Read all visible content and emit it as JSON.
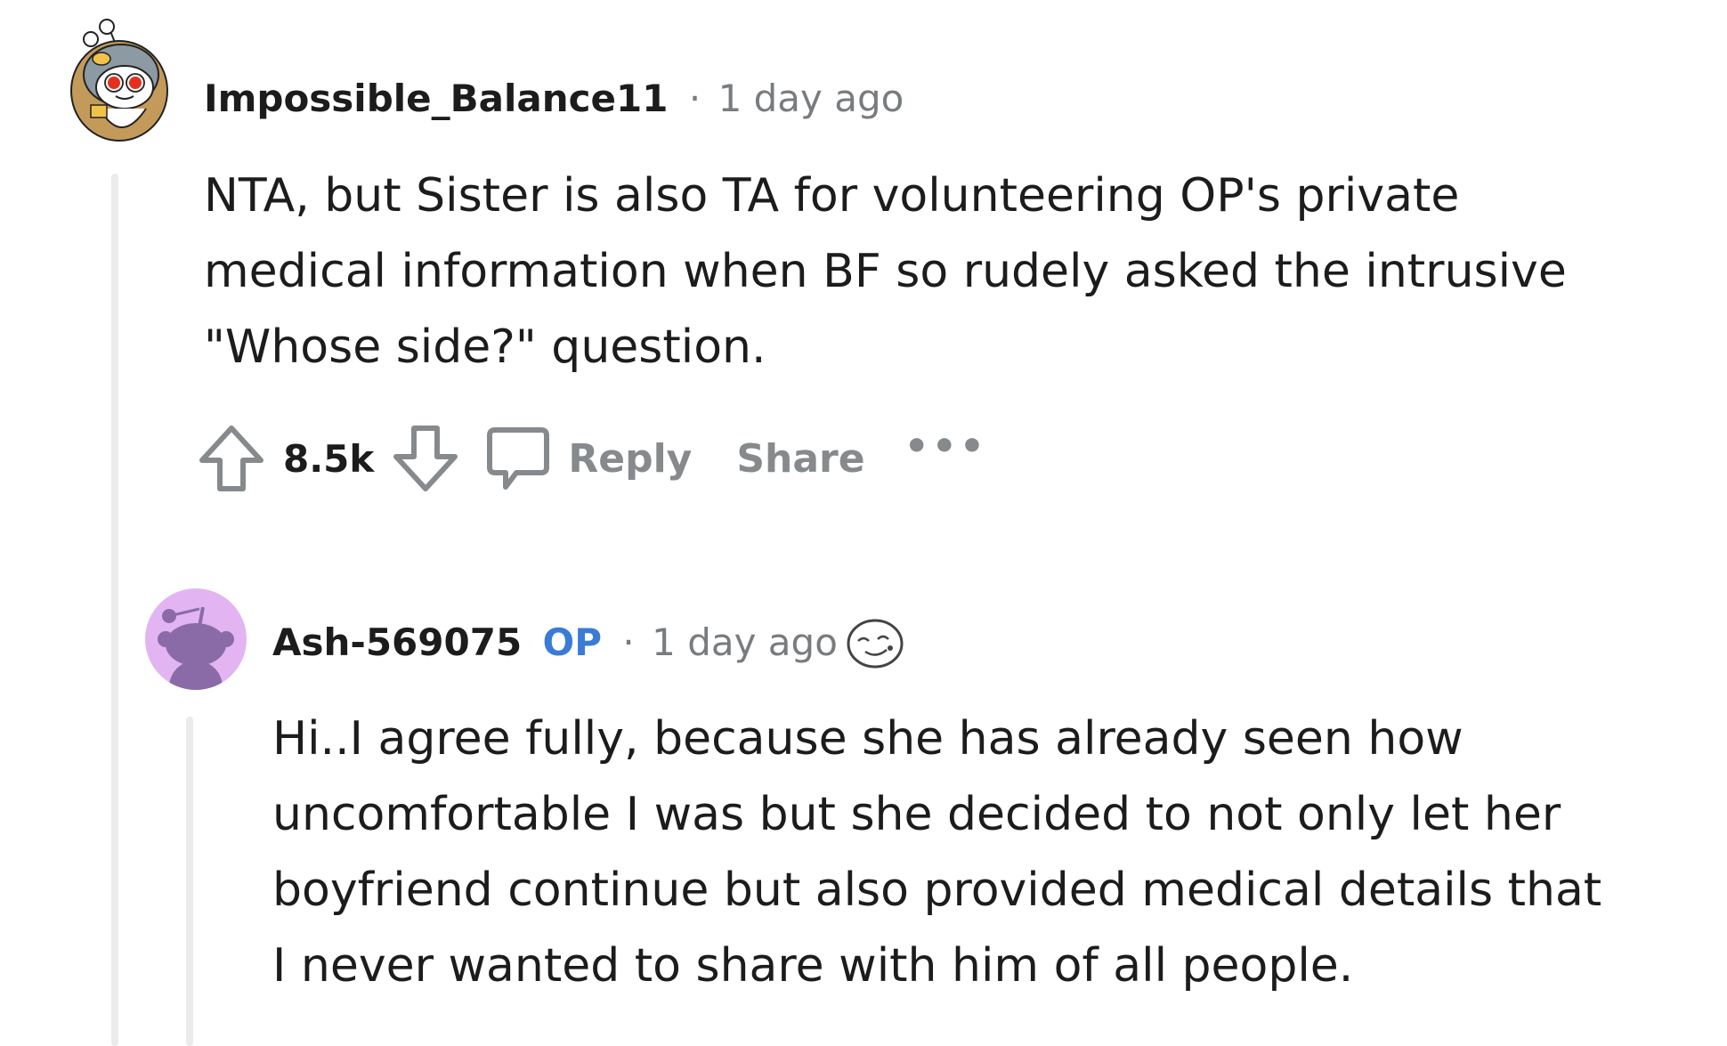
{
  "comment1": {
    "username": "Impossible_Balance11",
    "separator": "·",
    "timestamp": "1 day ago",
    "body_lines": [
      "NTA, but Sister is also TA for volunteering OP's private",
      "medical information when BF so rudely asked the intrusive",
      "\"Whose side?\" question."
    ],
    "votes": "8.5k",
    "actions": {
      "reply": "Reply",
      "share": "Share",
      "more": "•••"
    },
    "avatar_icon": "snoo-avatar-icon"
  },
  "comment2": {
    "username": "Ash-569075",
    "op_badge": "OP",
    "separator": "·",
    "timestamp": "1 day ago",
    "award_icon": "award-face-icon",
    "body_lines": [
      "Hi..I agree fully, because she has already seen how",
      "uncomfortable I was but she decided to not only let her",
      "boyfriend continue but also provided medical details that",
      "I never wanted to share with him of all people."
    ],
    "avatar_icon": "default-snoo-avatar-icon"
  },
  "colors": {
    "op_badge": "#3a7bd5",
    "meta_gray": "#787c7e",
    "action_gray": "#878a8c",
    "avatar2_bg": "#e2b5f2",
    "thread_line": "#ebebeb"
  }
}
